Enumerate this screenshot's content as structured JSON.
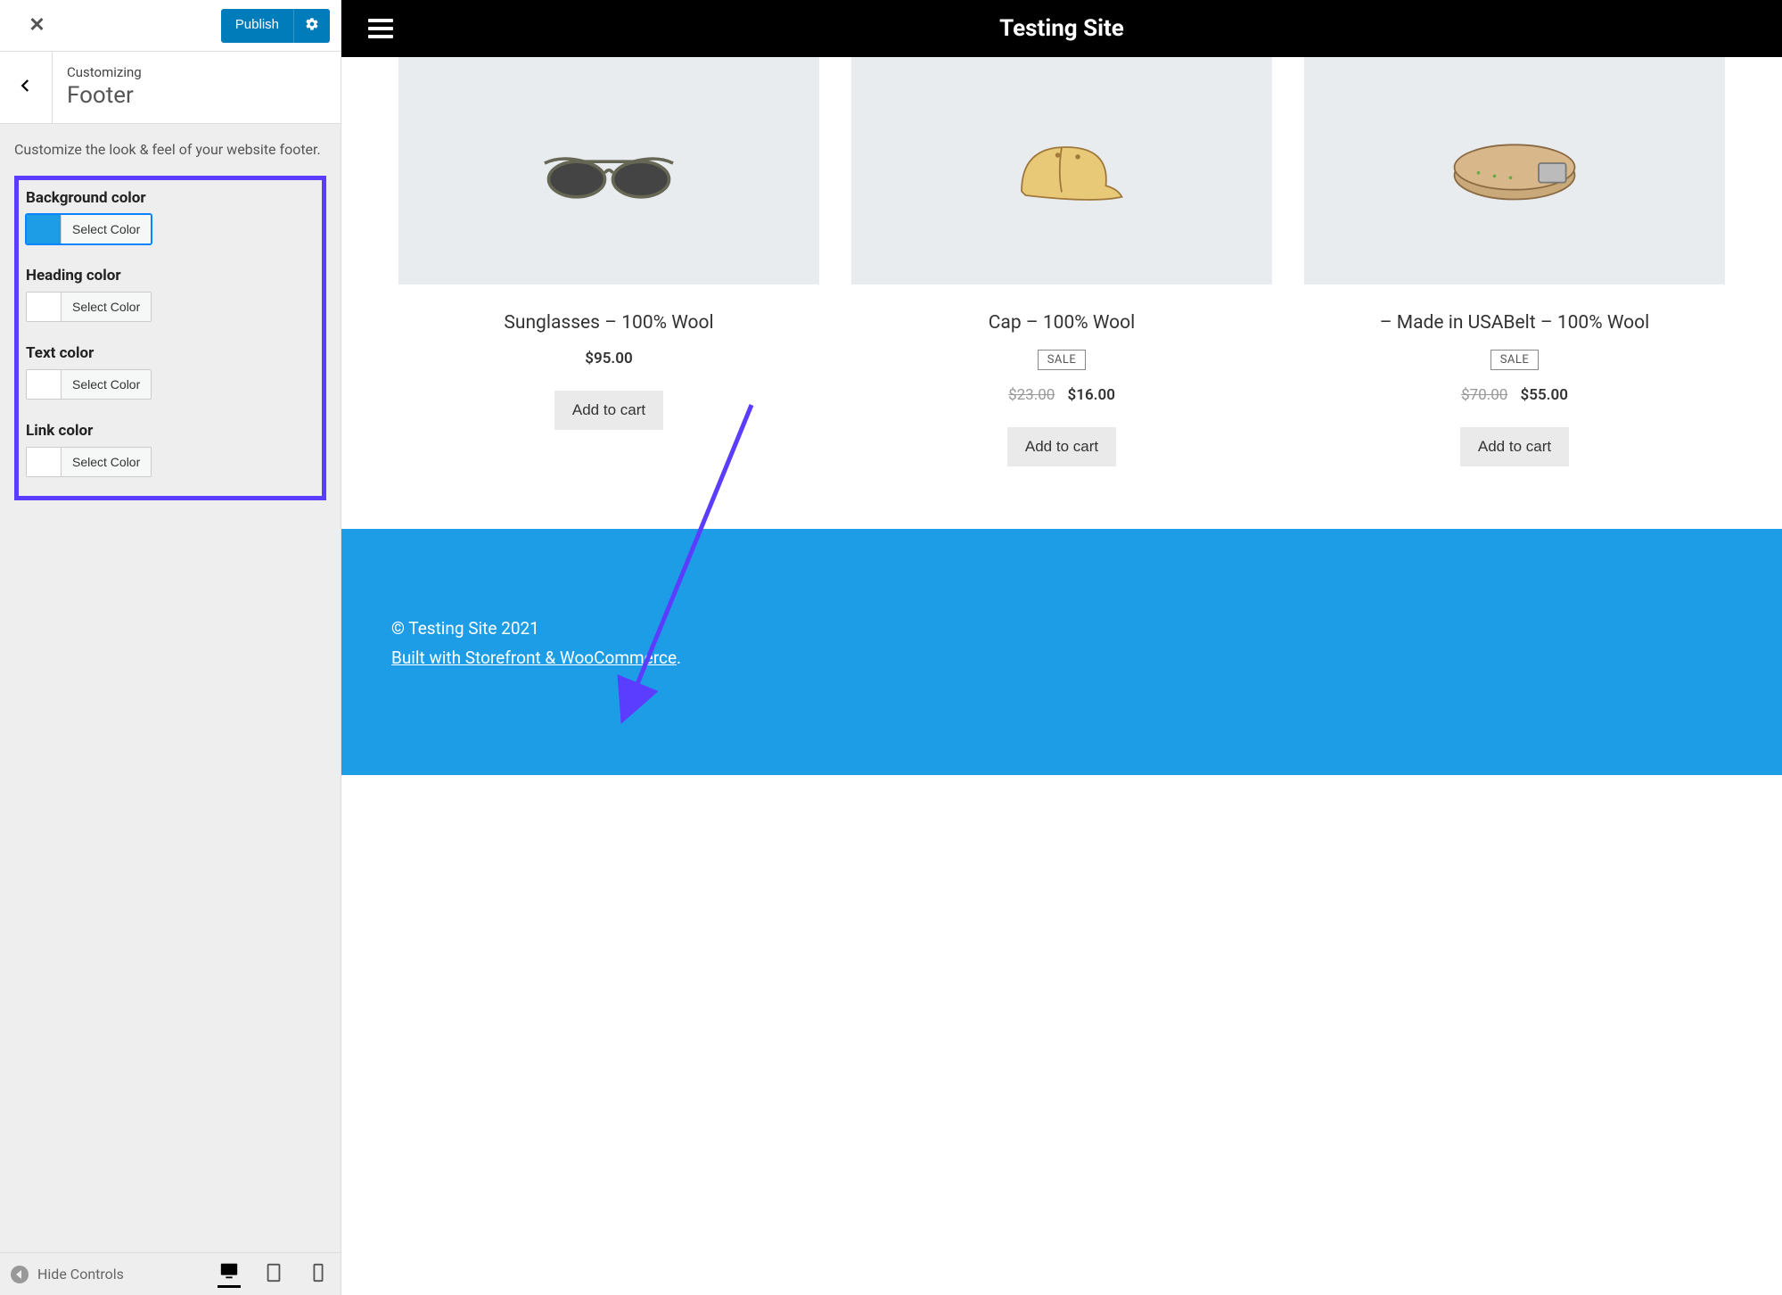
{
  "sidebar": {
    "publish_label": "Publish",
    "breadcrumb": "Customizing",
    "section_title": "Footer",
    "description": "Customize the look & feel of your website footer.",
    "select_color_label": "Select Color",
    "controls": {
      "bg": {
        "label": "Background color",
        "swatch": "#1e9de7",
        "active": true
      },
      "heading": {
        "label": "Heading color",
        "swatch": "#ffffff",
        "active": false
      },
      "text": {
        "label": "Text color",
        "swatch": "#ffffff",
        "active": false
      },
      "link": {
        "label": "Link color",
        "swatch": "#ffffff",
        "active": false
      }
    },
    "hide_controls_label": "Hide Controls"
  },
  "preview": {
    "site_title": "Testing Site",
    "add_to_cart_label": "Add to cart",
    "sale_badge": "SALE",
    "products": [
      {
        "title": "Sunglasses – 100% Wool",
        "price": "$95.00",
        "old_price": null,
        "sale": false
      },
      {
        "title": "Cap – 100% Wool",
        "price": "$16.00",
        "old_price": "$23.00",
        "sale": true
      },
      {
        "title": "– Made in USABelt – 100% Wool",
        "price": "$55.00",
        "old_price": "$70.00",
        "sale": true
      }
    ],
    "footer": {
      "copyright": "© Testing Site 2021",
      "built_text": "Built with Storefront & WooCommerce",
      "built_suffix": "."
    }
  }
}
